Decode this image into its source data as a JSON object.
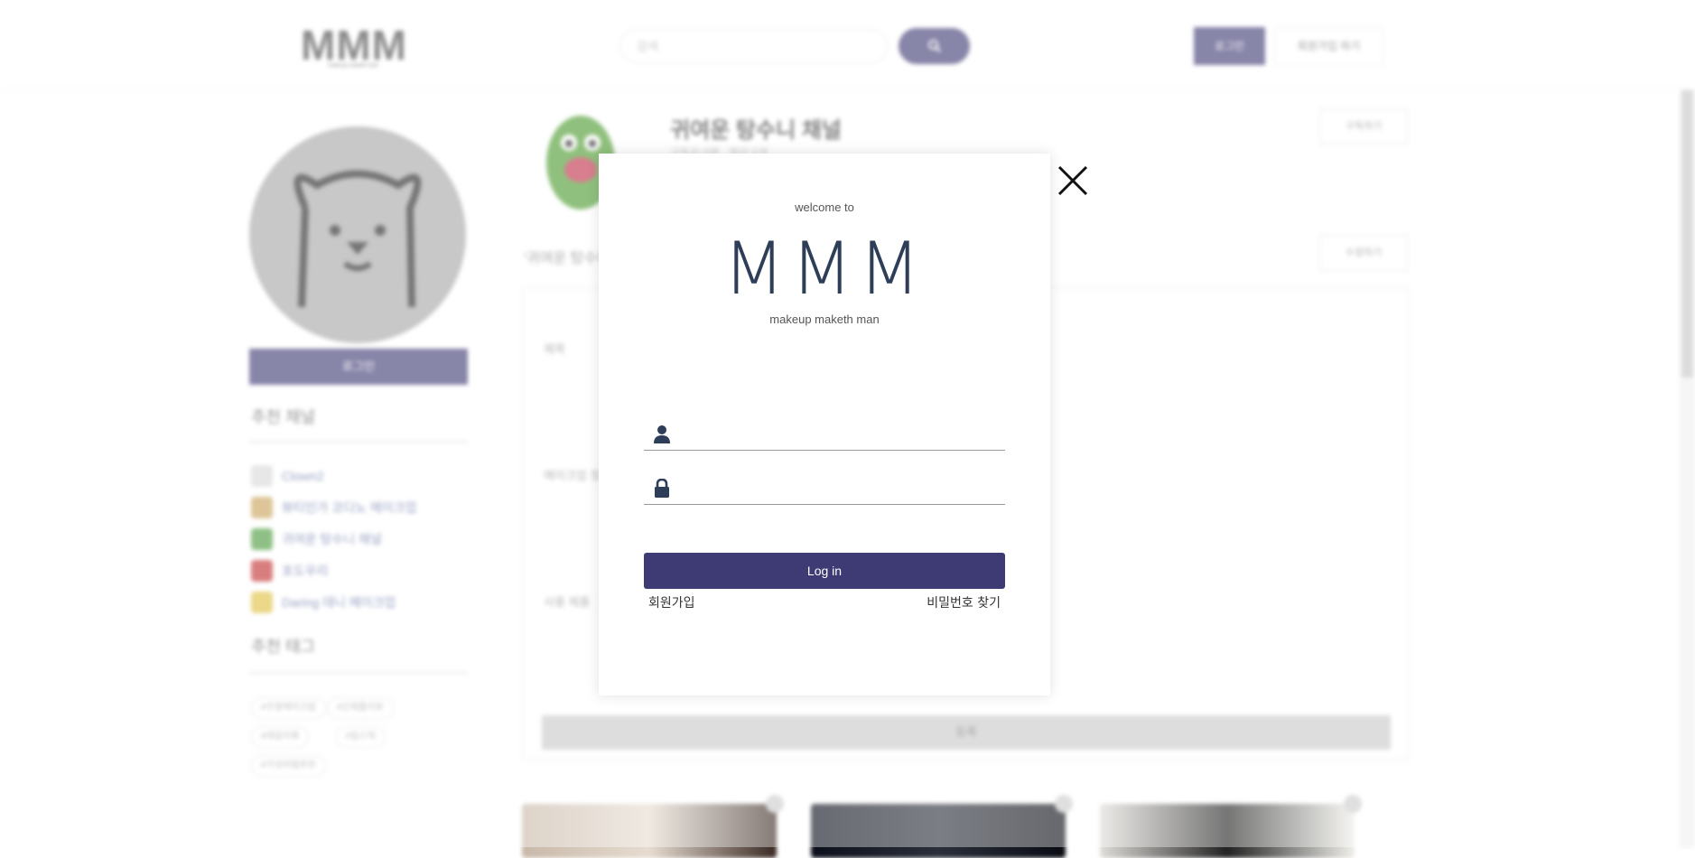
{
  "header": {
    "logo": "MMM",
    "logo_tagline": "makeup maketh man",
    "search_placeholder": "검색",
    "login_label": "로그인",
    "signup_label": "회원가입 하기"
  },
  "sidebar": {
    "login_label": "로그인",
    "recommended_channels_heading": "추천 채널",
    "channels": [
      {
        "name": "Clown2",
        "color": "#d8d8d8"
      },
      {
        "name": "뷰티인가 코디노 메이크업",
        "color": "#c9a25a"
      },
      {
        "name": "귀여운 탕수니 채널",
        "color": "#4a9a3a"
      },
      {
        "name": "포도우리",
        "color": "#c23030"
      },
      {
        "name": "Daring 데니 메이크업",
        "color": "#e0c040"
      }
    ],
    "recommended_tags_heading": "추천 태그",
    "tags": [
      "#주말메이크업",
      "#신제품리뷰",
      "#데일리룩",
      "#립스틱",
      "#가성비템추천"
    ]
  },
  "main": {
    "channel_title": "귀여운 탕수니 채널",
    "channel_sub": "구독자 0명 · 영상 0개",
    "subscribe_label": "구독하기",
    "quote": "'귀여운 탕수니 채널'",
    "edit_label": "수정하기",
    "form_labels": [
      "제목",
      "메이크업 정보",
      "사용 제품"
    ],
    "submit_label": "등록"
  },
  "modal": {
    "welcome": "welcome to",
    "logo": "MMM",
    "tagline": "makeup maketh man",
    "username_value": "",
    "password_value": "",
    "login_button": "Log in",
    "signup_link": "회원가입",
    "find_password_link": "비밀번호 찾기"
  },
  "colors": {
    "accent": "#3e3a73",
    "logo_text": "#2e3e58"
  }
}
